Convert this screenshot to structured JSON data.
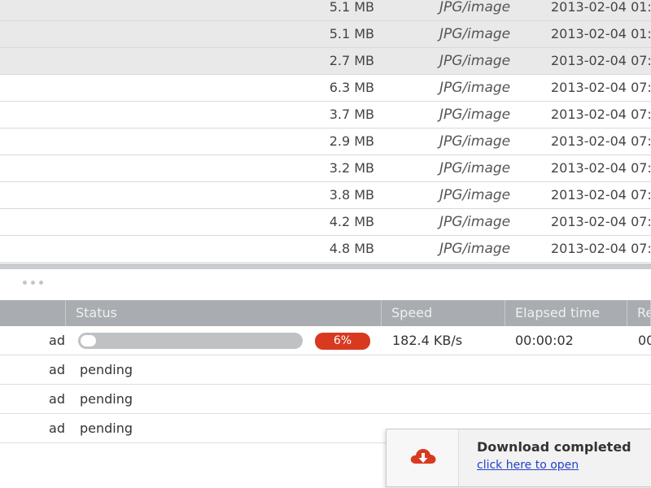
{
  "files": [
    {
      "size": "5.1 MB",
      "type": "JPG/image",
      "date": "2013-02-04 01:",
      "selected": true
    },
    {
      "size": "5.1 MB",
      "type": "JPG/image",
      "date": "2013-02-04 01:",
      "selected": true
    },
    {
      "size": "2.7 MB",
      "type": "JPG/image",
      "date": "2013-02-04 07:",
      "selected": true
    },
    {
      "size": "6.3 MB",
      "type": "JPG/image",
      "date": "2013-02-04 07:",
      "selected": false
    },
    {
      "size": "3.7 MB",
      "type": "JPG/image",
      "date": "2013-02-04 07:",
      "selected": false
    },
    {
      "size": "2.9 MB",
      "type": "JPG/image",
      "date": "2013-02-04 07:",
      "selected": false
    },
    {
      "size": "3.2 MB",
      "type": "JPG/image",
      "date": "2013-02-04 07:",
      "selected": false
    },
    {
      "size": "3.8 MB",
      "type": "JPG/image",
      "date": "2013-02-04 07:",
      "selected": false
    },
    {
      "size": "4.2 MB",
      "type": "JPG/image",
      "date": "2013-02-04 07:",
      "selected": false
    },
    {
      "size": "4.8 MB",
      "type": "JPG/image",
      "date": "2013-02-04 07:",
      "selected": false
    }
  ],
  "downloads": {
    "columns": [
      "",
      "Status",
      "Speed",
      "Elapsed time",
      "Re"
    ],
    "rows": [
      {
        "name": "ad",
        "progress": 0.06,
        "percent_label": "6%",
        "speed": "182.4 KB/s",
        "elapsed": "00:00:02",
        "remaining": "00"
      },
      {
        "name": "ad",
        "status": "pending"
      },
      {
        "name": "ad",
        "status": "pending"
      },
      {
        "name": "ad",
        "status": "pending"
      }
    ]
  },
  "notification": {
    "title": "Download completed",
    "link": "click here to open",
    "icon": "cloud-download-icon",
    "icon_color": "#d83a20"
  },
  "colors": {
    "accent": "#d83a20",
    "header_bg": "#a9adb1",
    "selected_row": "#e9e9e9",
    "link": "#2442c8"
  }
}
